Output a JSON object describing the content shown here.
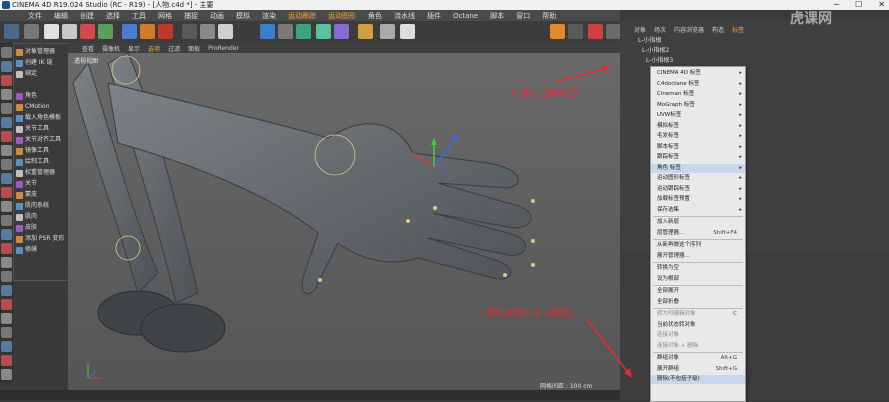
{
  "window": {
    "title": "CINEMA 4D R19.024 Studio (RC - R19) - [人物.c4d *] - 主要",
    "controls": [
      "─",
      "☐",
      "✕"
    ]
  },
  "menubar": {
    "items": [
      "文件",
      "编辑",
      "创建",
      "选择",
      "工具",
      "网格",
      "捕捉",
      "动画",
      "模拟",
      "渲染",
      "运动跟踪",
      "运动图形",
      "角色",
      "流水线",
      "插件",
      "Octane",
      "脚本",
      "窗口",
      "帮助"
    ],
    "highlight": [
      "运动跟踪",
      "运动图形"
    ]
  },
  "viewport": {
    "menu": [
      "查看",
      "摄像机",
      "显示",
      "选项",
      "过滤",
      "面板",
      "ProRender"
    ],
    "menu_highlight": "选项",
    "label": "透视视图",
    "grid_info": "网格间距 : 100 cm"
  },
  "left_panel": {
    "items": [
      "对象管理器",
      "创建 IK 链",
      "绑定",
      "角色",
      "CMotion",
      "载入角色模板",
      "关节工具",
      "关节对齐工具",
      "镜像工具",
      "绘制工具",
      "权重管理器",
      "关节",
      "蒙皮",
      "肌肉系统",
      "肌肉",
      "皮肤",
      "添加 PSR 变形",
      "修缮"
    ]
  },
  "right_panel": {
    "tabs": [
      "对象",
      "场次",
      "内容浏览器",
      "构造",
      "标签"
    ],
    "tab_highlight": "标签",
    "objects": [
      "L-小指根",
      "L-小指根2",
      "L-小指根3",
      "L-小指末端"
    ]
  },
  "context_menu": {
    "items": [
      {
        "label": "CINEMA 4D 标签",
        "arrow": true
      },
      {
        "label": "C4doctane 标签",
        "arrow": true
      },
      {
        "label": "Cineman 标签",
        "arrow": true
      },
      {
        "label": "MoGraph 标签",
        "arrow": true
      },
      {
        "label": "UVW标签",
        "arrow": true
      },
      {
        "label": "模拟标签",
        "arrow": true
      },
      {
        "label": "毛发标签",
        "arrow": true
      },
      {
        "label": "脚本标签",
        "arrow": true
      },
      {
        "label": "跟踪标签",
        "arrow": true
      },
      {
        "label": "角色 标签",
        "arrow": true,
        "highlight": true
      },
      {
        "label": "运动图形标签",
        "arrow": true
      },
      {
        "label": "运动跟踪标签",
        "arrow": true
      },
      {
        "label": "加载标签预置",
        "arrow": true
      },
      {
        "label": "保存选集",
        "arrow": true
      },
      {
        "label": "加入新层",
        "arrow": false
      },
      {
        "label": "层管理器...",
        "shortcut": "Shift+F4"
      },
      {
        "label": "从新再做这个序列"
      },
      {
        "label": "展开管理器..."
      },
      {
        "label": "转换为空"
      },
      {
        "label": "设为根部"
      },
      {
        "label": "全部展开"
      },
      {
        "label": "全部折叠"
      },
      {
        "label": "转为可编辑对象",
        "shortcut": "C",
        "dim": true
      },
      {
        "label": "当前状态转对象"
      },
      {
        "label": "连接对象",
        "dim": true
      },
      {
        "label": "连接对象 + 删除",
        "dim": true
      },
      {
        "label": "群组对象",
        "shortcut": "Alt+G"
      },
      {
        "label": "展开群组",
        "shortcut": "Shift+G"
      },
      {
        "label": "删除(不包括子级)",
        "highlight": true
      }
    ]
  },
  "annotations": {
    "step2": "2 进行【重命名】",
    "step1": "1 鼠标右键点击【删除】"
  },
  "watermark": "虎课网",
  "colors": {
    "accent": "#f6a73c",
    "annotation": "#e52b2b",
    "menu_bg": "#e9e9e9",
    "viewport_bg": "#5e5e5e"
  }
}
